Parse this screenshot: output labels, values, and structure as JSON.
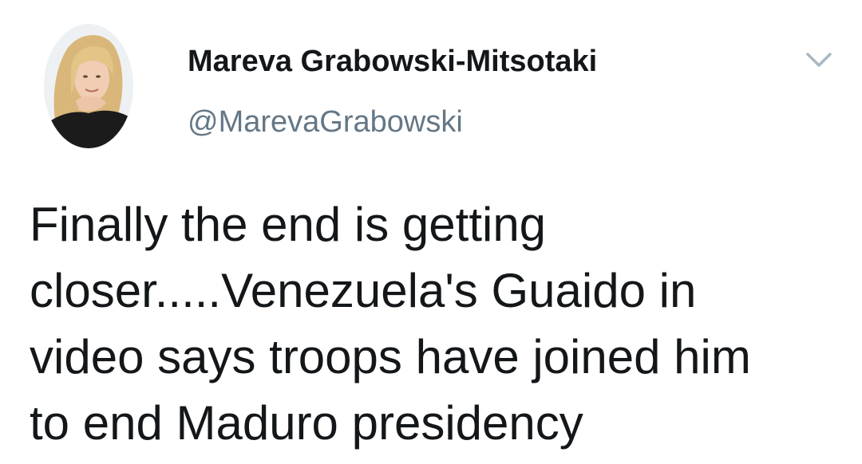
{
  "tweet": {
    "author": {
      "display_name": "Mareva Grabowski-Mitsotaki",
      "handle": "@MarevaGrabowski",
      "avatar_icon": "profile-photo"
    },
    "menu_icon": "chevron-down-icon",
    "text_lines": [
      "Finally the end is getting",
      "closer.....Venezuela's Guaido in",
      "video says troops have joined him",
      "to end Maduro presidency"
    ]
  },
  "colors": {
    "primary_text": "#14171a",
    "secondary_text": "#657786",
    "caret": "#aab8c2",
    "background": "#ffffff"
  }
}
